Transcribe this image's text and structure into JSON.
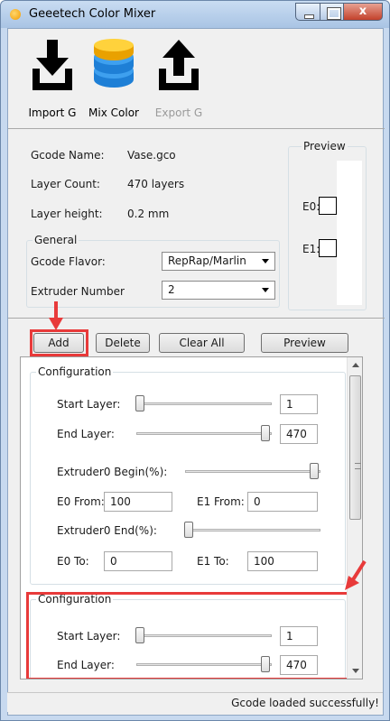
{
  "window": {
    "title": "Geeetech Color Mixer",
    "close_glyph": "x"
  },
  "toolbar": {
    "import_label": "Import G",
    "mix_label": "Mix Color",
    "export_label": "Export G"
  },
  "info": {
    "gcode_name_label": "Gcode Name:",
    "gcode_name_value": "Vase.gco",
    "layer_count_label": "Layer Count:",
    "layer_count_value": "470 layers",
    "layer_height_label": "Layer height:",
    "layer_height_value": "0.2 mm"
  },
  "general": {
    "title": "General",
    "flavor_label": "Gcode Flavor:",
    "flavor_value": "RepRap/Marlin",
    "extruder_label": "Extruder Number",
    "extruder_value": "2"
  },
  "preview": {
    "title": "Preview",
    "e0_label": "E0:",
    "e1_label": "E1:"
  },
  "buttons": {
    "add": "Add",
    "delete": "Delete",
    "clear_all": "Clear All",
    "preview": "Preview"
  },
  "configurations": [
    {
      "title": "Configuration",
      "start_layer_label": "Start Layer:",
      "start_layer_value": "1",
      "end_layer_label": "End Layer:",
      "end_layer_value": "470",
      "e0_begin_label": "Extruder0 Begin(%):",
      "e0_from_label": "E0 From:",
      "e0_from_value": "100",
      "e1_from_label": "E1 From:",
      "e1_from_value": "0",
      "e0_end_label": "Extruder0 End(%):",
      "e0_to_label": "E0 To:",
      "e0_to_value": "0",
      "e1_to_label": "E1 To:",
      "e1_to_value": "100"
    },
    {
      "title": "Configuration",
      "start_layer_label": "Start Layer:",
      "start_layer_value": "1",
      "end_layer_label": "End Layer:",
      "end_layer_value": "470"
    }
  ],
  "status": {
    "text": "Gcode loaded successfully!"
  },
  "colors": {
    "highlight": "#e83a3a",
    "titlebar": "#b9d0ec",
    "mix_icon": "#2f8fe0"
  },
  "icons": {
    "import": "download-tray-icon",
    "mix": "database-icon",
    "export": "upload-tray-icon"
  }
}
